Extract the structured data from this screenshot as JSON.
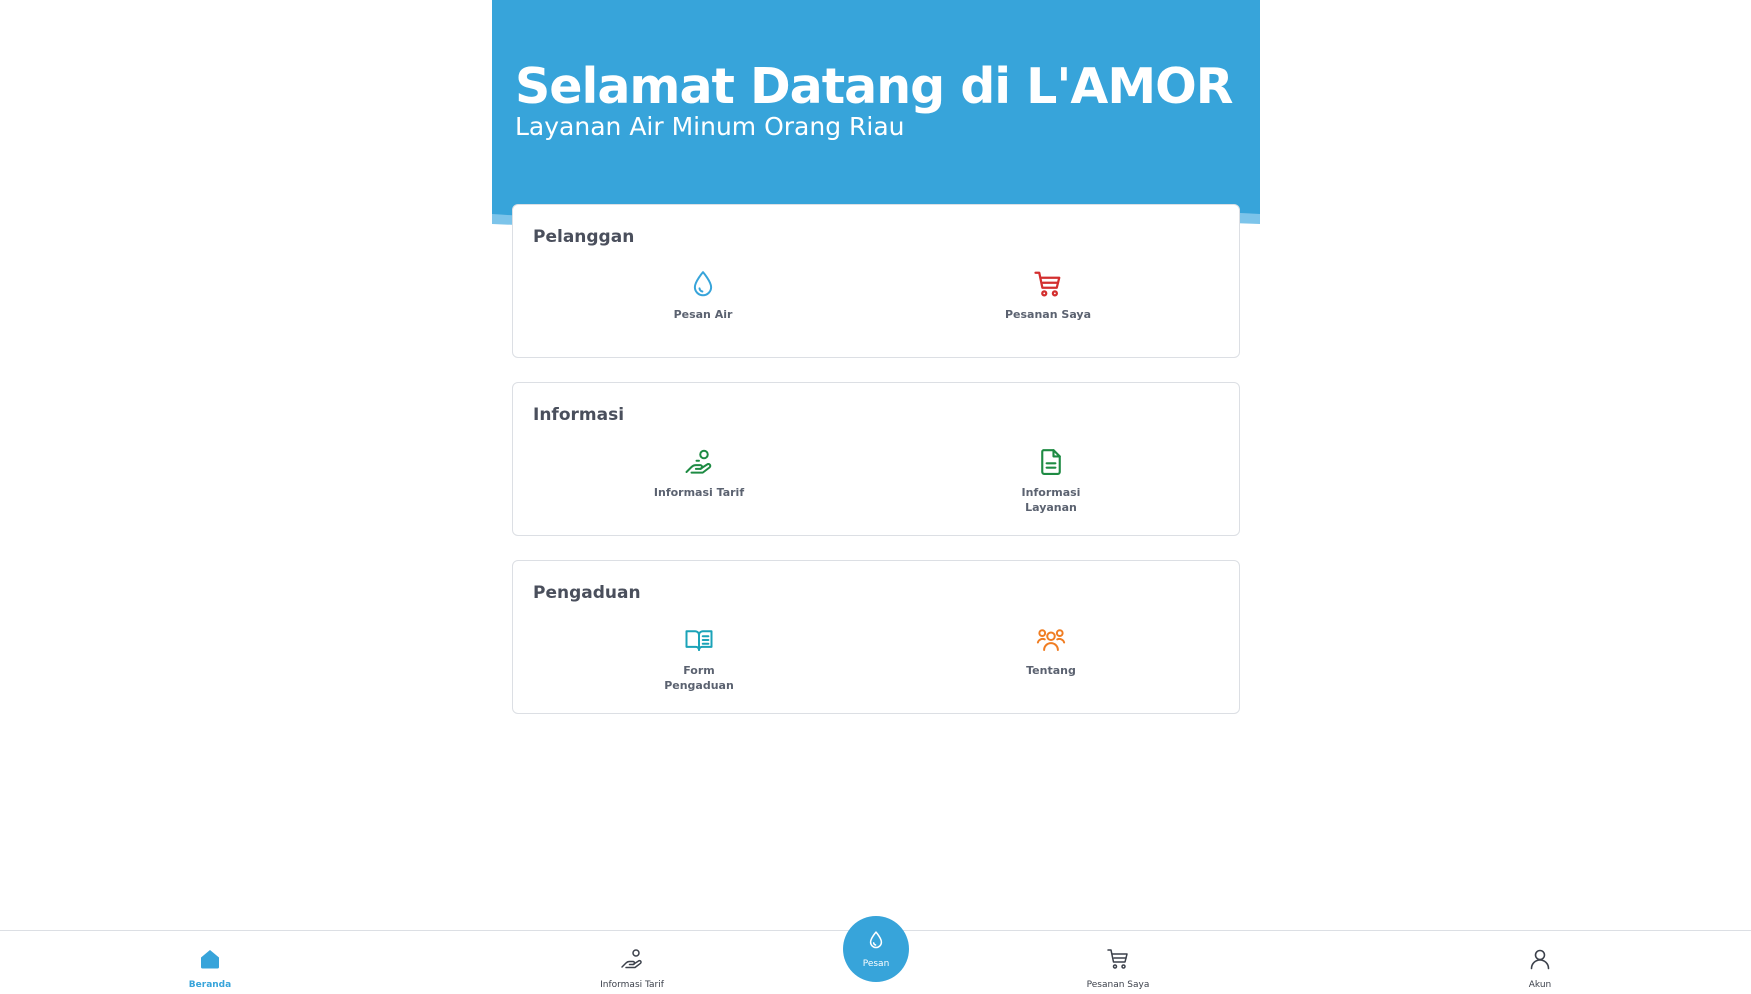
{
  "header": {
    "title": "Selamat Datang di L'AMOR",
    "subtitle": "Layanan Air Minum Orang Riau"
  },
  "sections": [
    {
      "title": "Pelanggan",
      "items": [
        {
          "label": "Pesan Air",
          "icon": "water-drop-icon",
          "color": "#37a4da"
        },
        {
          "label": "Pesanan Saya",
          "icon": "cart-icon",
          "color": "#d32f2f"
        }
      ]
    },
    {
      "title": "Informasi",
      "items": [
        {
          "label": "Informasi Tarif",
          "icon": "hand-coin-icon",
          "color": "#1e8b43"
        },
        {
          "label": "Informasi\nLayanan",
          "icon": "document-icon",
          "color": "#1e8b43"
        }
      ]
    },
    {
      "title": "Pengaduan",
      "items": [
        {
          "label": "Form\nPengaduan",
          "icon": "book-icon",
          "color": "#1ba3b8"
        },
        {
          "label": "Tentang",
          "icon": "group-icon",
          "color": "#f07d22"
        }
      ]
    }
  ],
  "bottom_nav": {
    "items": [
      {
        "label": "Beranda",
        "icon": "home-icon",
        "active": true
      },
      {
        "label": "Informasi Tarif",
        "icon": "hand-coin-icon",
        "active": false
      },
      {
        "label": "Pesanan Saya",
        "icon": "cart-icon",
        "active": false
      },
      {
        "label": "Akun",
        "icon": "user-icon",
        "active": false
      }
    ],
    "fab": {
      "label": "Pesan",
      "icon": "water-drop-icon"
    }
  },
  "colors": {
    "primary": "#37a4da",
    "text": "#4a4f5c"
  }
}
